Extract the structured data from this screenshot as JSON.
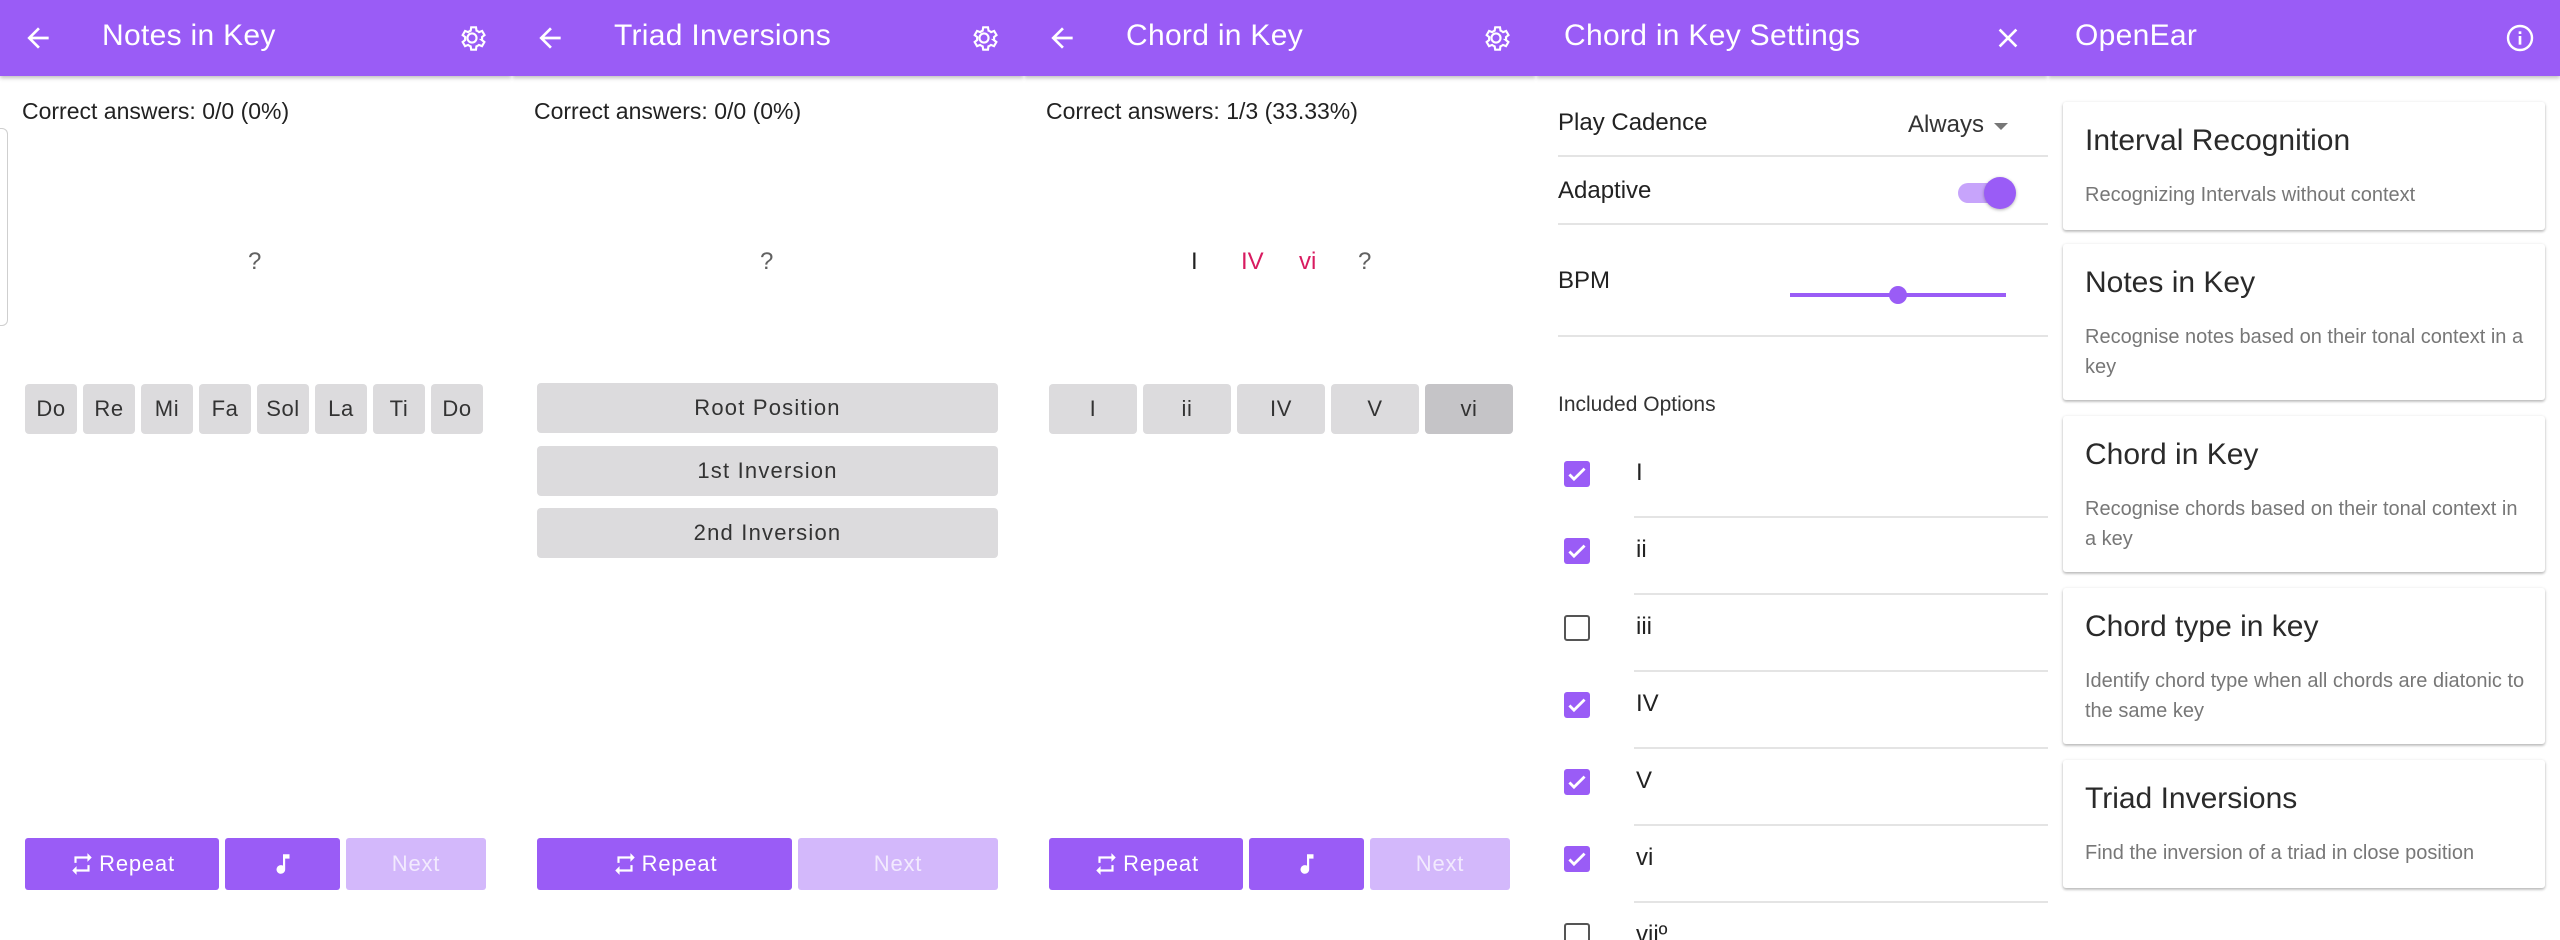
{
  "colors": {
    "accent": "#9a5cf6",
    "accent_disabled": "#d3b8fb",
    "wrong": "#d81b60",
    "option_bg": "#dcdbdd"
  },
  "icons": {
    "back": "arrow-left-icon",
    "settings": "gear-icon",
    "close": "close-icon",
    "info": "info-icon",
    "repeat": "repeat-icon",
    "music": "music-note-icon"
  },
  "notes_in_key": {
    "title": "Notes in Key",
    "score": "Correct answers: 0/0 (0%)",
    "sequence": [
      "?"
    ],
    "options": [
      "Do",
      "Re",
      "Mi",
      "Fa",
      "Sol",
      "La",
      "Ti",
      "Do"
    ],
    "repeat_label": "Repeat",
    "next_label": "Next"
  },
  "triad_inversions": {
    "title": "Triad Inversions",
    "score": "Correct answers: 0/0 (0%)",
    "sequence": [
      "?"
    ],
    "options": [
      "Root Position",
      "1st Inversion",
      "2nd Inversion"
    ],
    "repeat_label": "Repeat",
    "next_label": "Next"
  },
  "chord_in_key": {
    "title": "Chord in Key",
    "score": "Correct answers: 1/3 (33.33%)",
    "sequence": [
      "I",
      "IV",
      "vi",
      "?"
    ],
    "options": [
      "I",
      "ii",
      "IV",
      "V",
      "vi"
    ],
    "selected_option": "vi",
    "repeat_label": "Repeat",
    "next_label": "Next"
  },
  "settings": {
    "title": "Chord in Key Settings",
    "play_cadence_label": "Play Cadence",
    "play_cadence_value": "Always",
    "adaptive_label": "Adaptive",
    "adaptive_on": true,
    "bpm_label": "BPM",
    "bpm_fraction": 0.5,
    "included_header": "Included Options",
    "included": [
      {
        "label": "I",
        "checked": true
      },
      {
        "label": "ii",
        "checked": true
      },
      {
        "label": "iii",
        "checked": false
      },
      {
        "label": "IV",
        "checked": true
      },
      {
        "label": "V",
        "checked": true
      },
      {
        "label": "vi",
        "checked": true
      },
      {
        "label": "viiº",
        "checked": false
      }
    ]
  },
  "openear": {
    "title": "OpenEar",
    "exercises": [
      {
        "title": "Interval Recognition",
        "description": "Recognizing Intervals without context"
      },
      {
        "title": "Notes in Key",
        "description": "Recognise notes based on their tonal context in a key"
      },
      {
        "title": "Chord in Key",
        "description": "Recognise chords based on their tonal context in a key"
      },
      {
        "title": "Chord type in key",
        "description": "Identify chord type when all chords are diatonic to the same key"
      },
      {
        "title": "Triad Inversions",
        "description": "Find the inversion of a triad in close position"
      }
    ]
  }
}
